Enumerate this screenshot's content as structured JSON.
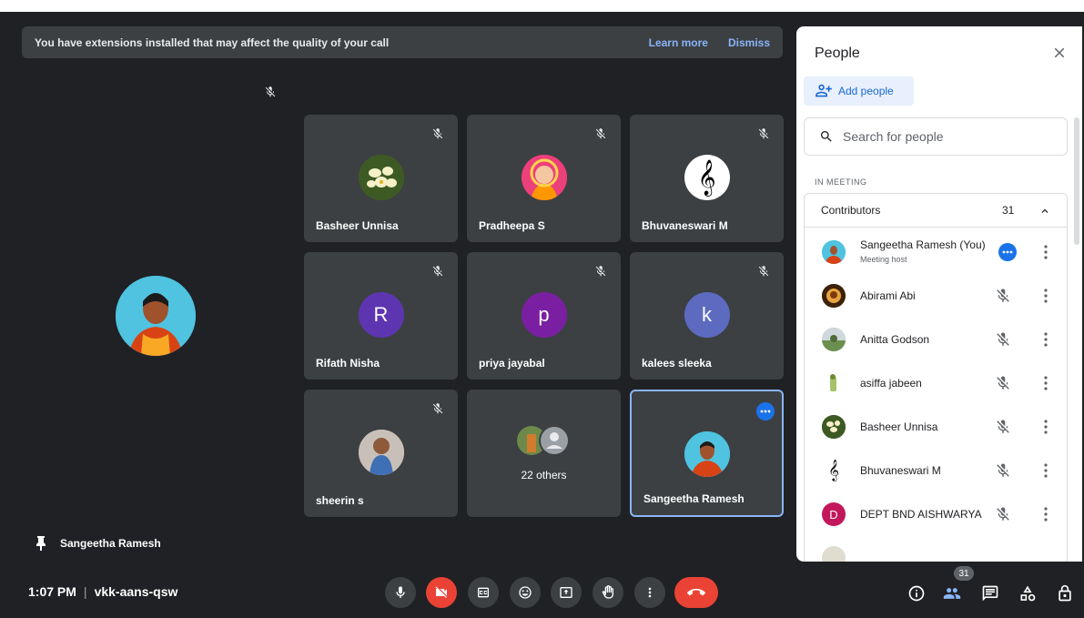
{
  "banner": {
    "message": "You have extensions installed that may affect the quality of your call",
    "learn_more": "Learn more",
    "dismiss": "Dismiss"
  },
  "tiles": [
    {
      "name": "Basheer Unnisa",
      "avatar": "flower-photo"
    },
    {
      "name": "Pradheepa S",
      "avatar": "saint-photo"
    },
    {
      "name": "Bhuvaneswari M",
      "avatar": "treble-clef"
    },
    {
      "name": "Rifath Nisha",
      "initial": "R",
      "color": "#5e35b1"
    },
    {
      "name": "priya jayabal",
      "initial": "p",
      "color": "#7b1fa2"
    },
    {
      "name": "kalees sleeka",
      "initial": "k",
      "color": "#5c6bc0"
    },
    {
      "name": "sheerin s",
      "avatar": "child-photo"
    },
    {
      "name": "22 others",
      "avatar": "group-avatars"
    },
    {
      "name": "Sangeetha Ramesh",
      "avatar": "woman-photo"
    }
  ],
  "pinned": {
    "name": "Sangeetha Ramesh"
  },
  "bottom": {
    "time": "1:07 PM",
    "meeting_code": "vkk-aans-qsw",
    "people_count": "31"
  },
  "panel": {
    "title": "People",
    "add_people": "Add people",
    "search_placeholder": "Search for people",
    "section": "IN MEETING",
    "group_label": "Contributors",
    "group_count": "31",
    "people": [
      {
        "name": "Sangeetha Ramesh (You)",
        "sub": "Meeting host",
        "avatar": "woman-photo"
      },
      {
        "name": "Abirami Abi",
        "avatar": "deity-photo"
      },
      {
        "name": "Anitta Godson",
        "avatar": "landscape-photo"
      },
      {
        "name": "asiffa jabeen",
        "avatar": "figure-photo"
      },
      {
        "name": "Basheer Unnisa",
        "avatar": "flower-photo"
      },
      {
        "name": "Bhuvaneswari M",
        "avatar": "treble-clef"
      },
      {
        "name": "DEPT BND AISHWARYA",
        "initial": "D",
        "color": "#c2185b"
      }
    ]
  },
  "colors": {
    "background": "#202124",
    "tile": "#3c4043",
    "accent": "#8ab4f8",
    "end_call": "#ea4335",
    "panel_accent": "#1a73e8"
  }
}
